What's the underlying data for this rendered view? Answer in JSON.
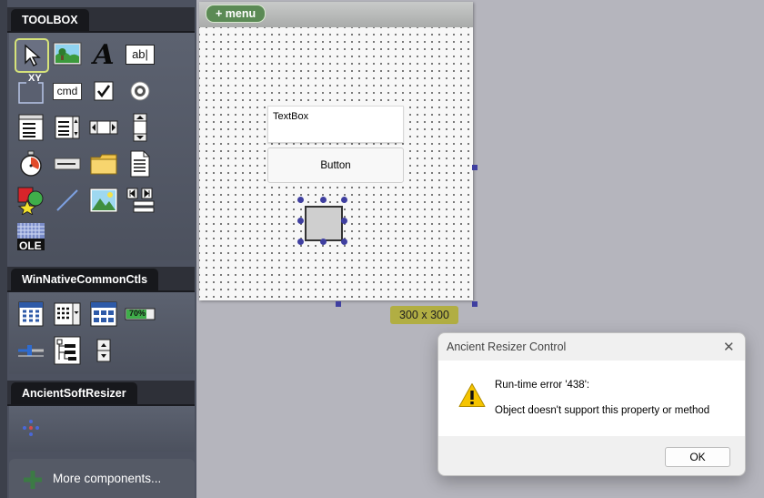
{
  "toolbox": {
    "title": "TOOLBOX",
    "sections": [
      {
        "label": "WinNativeCommonCtls"
      },
      {
        "label": "AncientSoftResizer"
      }
    ],
    "more_label": "More components...",
    "tools": {
      "label_text": "A",
      "textbox_glyph": "ab|",
      "coord_label": "XY",
      "command_label": "cmd",
      "ole_label": "OLE",
      "progress_label": "70%"
    }
  },
  "form": {
    "menu_label": "+ menu",
    "textbox_text": "TextBox",
    "button_label": "Button",
    "size_badge": "300 x 300"
  },
  "dialog": {
    "title": "Ancient Resizer Control",
    "close": "✕",
    "message_line1": "Run-time error '438':",
    "message_line2": "Object doesn't support this property or method",
    "ok_label": "OK"
  },
  "colors": {
    "toolbox_bg": "#4d5260",
    "menu_button": "#5b8a55",
    "selection_handle": "#3f3fa0",
    "size_badge": "#b1ae43",
    "warning_yellow": "#f5c400"
  }
}
